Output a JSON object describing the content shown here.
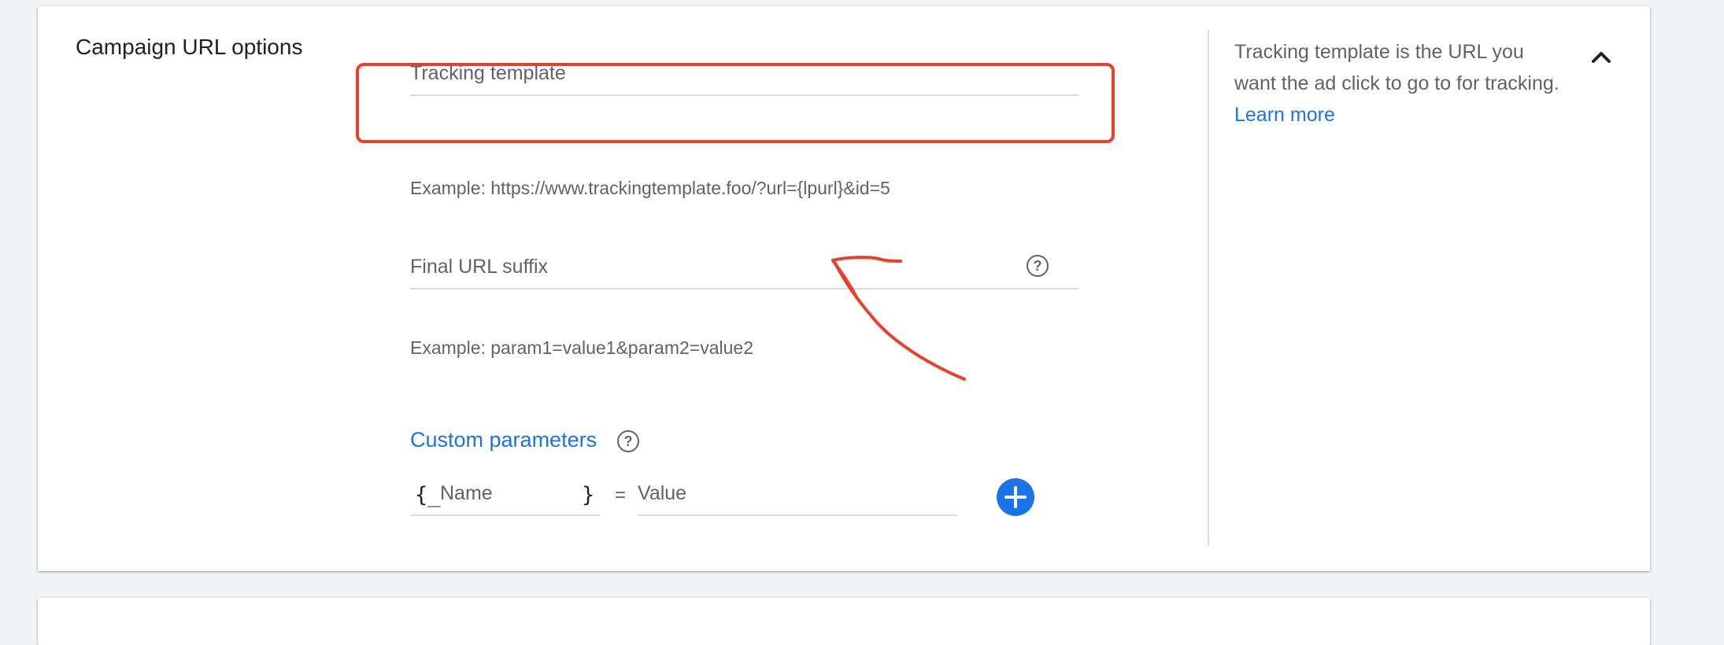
{
  "section": {
    "title": "Campaign URL options"
  },
  "tracking_template": {
    "label": "Tracking template",
    "example": "Example: https://www.trackingtemplate.foo/?url={lpurl}&id=5"
  },
  "final_url_suffix": {
    "label": "Final URL suffix",
    "example": "Example: param1=value1&param2=value2"
  },
  "custom_parameters": {
    "label": "Custom parameters",
    "brace_open": "{_",
    "name_placeholder": "Name",
    "brace_close": "}",
    "equals": "=",
    "value_placeholder": "Value"
  },
  "side_help": {
    "text": "Tracking template is the URL you want the ad click to go to for tracking.",
    "link": "Learn more"
  },
  "colors": {
    "accent": "#1a73e8",
    "annotation_red": "#e8402a",
    "text_secondary": "#5f6368"
  },
  "icons": {
    "help": "help-circle-icon",
    "collapse": "chevron-up-icon",
    "add": "plus-icon"
  }
}
